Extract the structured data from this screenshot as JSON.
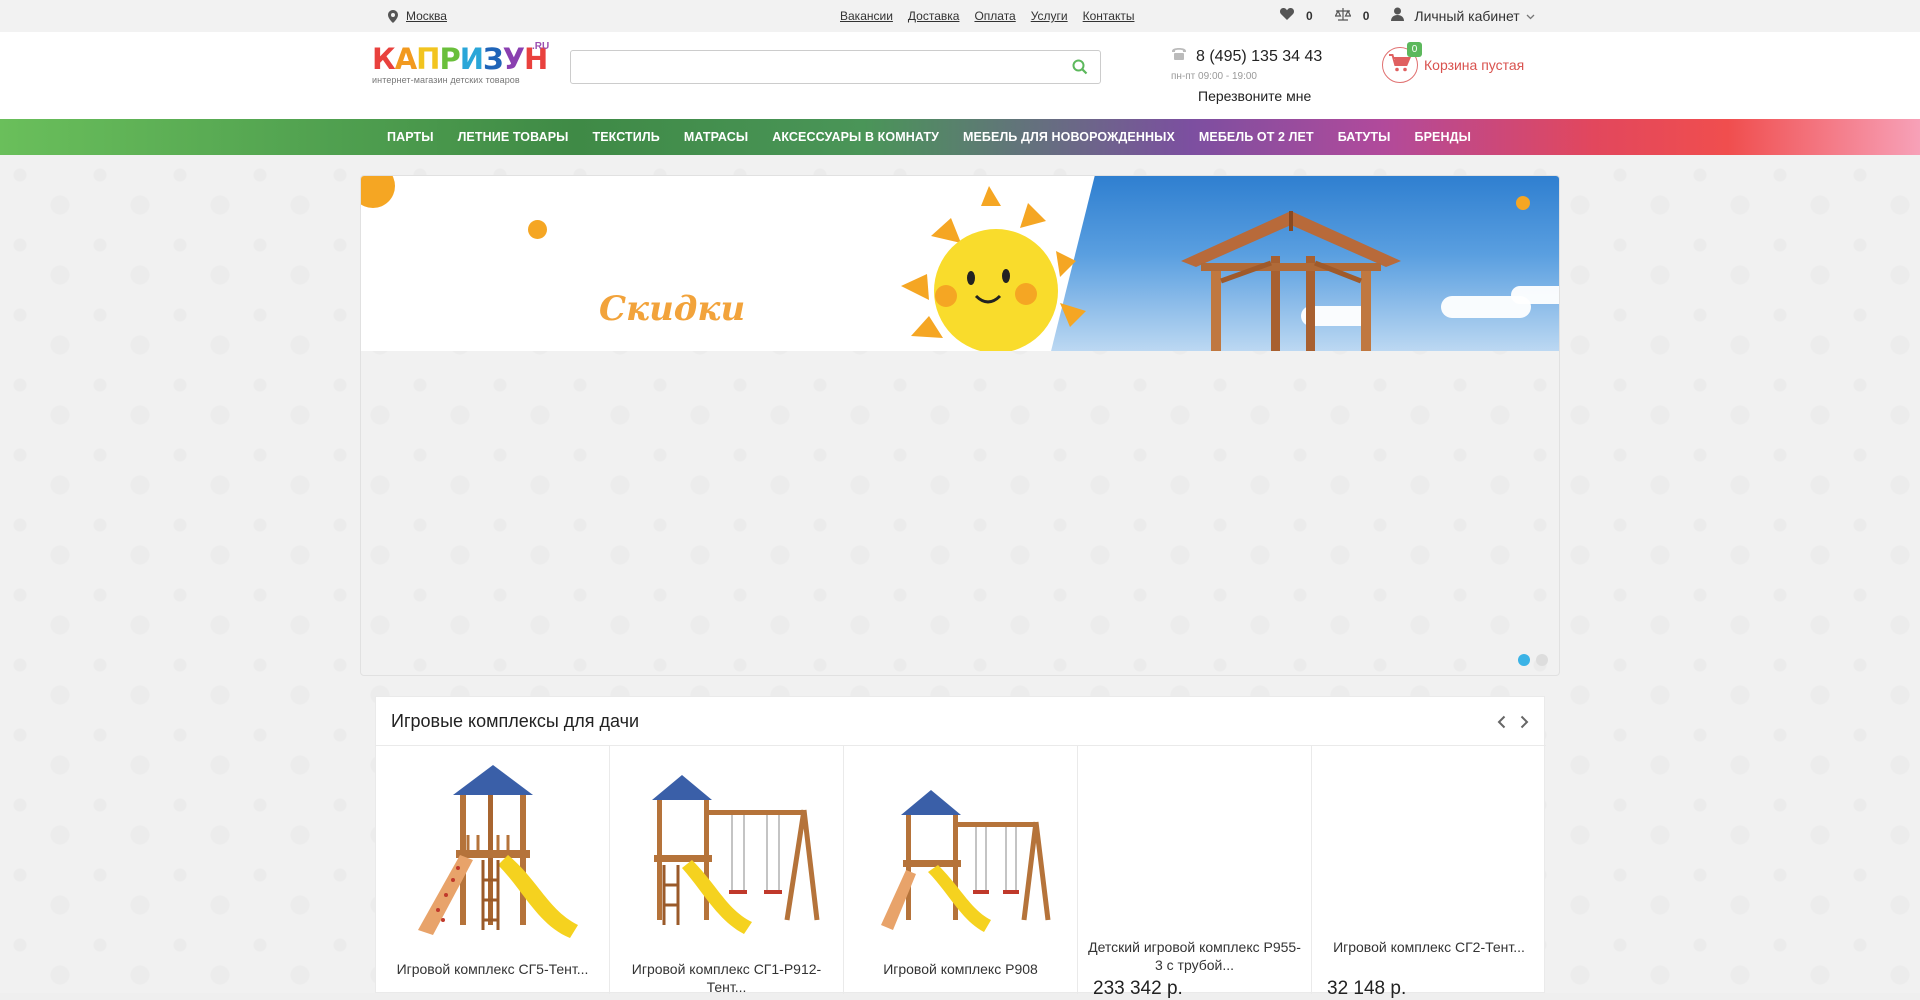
{
  "topbar": {
    "city": "Москва",
    "nav": [
      "Вакансии",
      "Доставка",
      "Оплата",
      "Услуги",
      "Контакты"
    ],
    "favorites_count": "0",
    "compare_count": "0",
    "account_label": "Личный кабинет"
  },
  "header": {
    "logo_word": "КАПРИЗУН",
    "logo_suffix": ".RU",
    "logo_tagline": "интернет-магазин детских товаров",
    "search_placeholder": "",
    "phone": "8 (495) 135 34 43",
    "hours": "пн-пт 09:00 - 19:00",
    "callback": "Перезвоните мне",
    "cart_count": "0",
    "cart_label": "Корзина пустая"
  },
  "menu": {
    "items": [
      "Парты",
      "Летние товары",
      "Текстиль",
      "Матрасы",
      "Аксессуары в комнату",
      "Мебель для новорожденных",
      "Мебель от 2 лет",
      "Батуты",
      "Бренды"
    ]
  },
  "slider": {
    "banner_text": "Скидки",
    "active_dot": 0,
    "dot_count": 2
  },
  "products": {
    "title": "Игровые комплексы для дачи",
    "items": [
      {
        "name": "Игровой комплекс СГ5-Тент...",
        "price": "",
        "image": "play-tower-climbing-wall"
      },
      {
        "name": "Игровой комплекс СГ1-Р912-Тент...",
        "price": "",
        "image": "play-tower-swings"
      },
      {
        "name": "Игровой комплекс Р908",
        "price": "",
        "image": "play-tower-swings-small"
      },
      {
        "name": "Детский игровой комплекс Р955-3 с трубой...",
        "price": "233 342 р.",
        "image": ""
      },
      {
        "name": "Игровой комплекс СГ2-Тент...",
        "price": "32 148 р.",
        "image": ""
      }
    ]
  },
  "colors": {
    "accent_green": "#5cb85c",
    "cart_red": "#d9534f",
    "slider_dot_active": "#3bb3e6"
  }
}
